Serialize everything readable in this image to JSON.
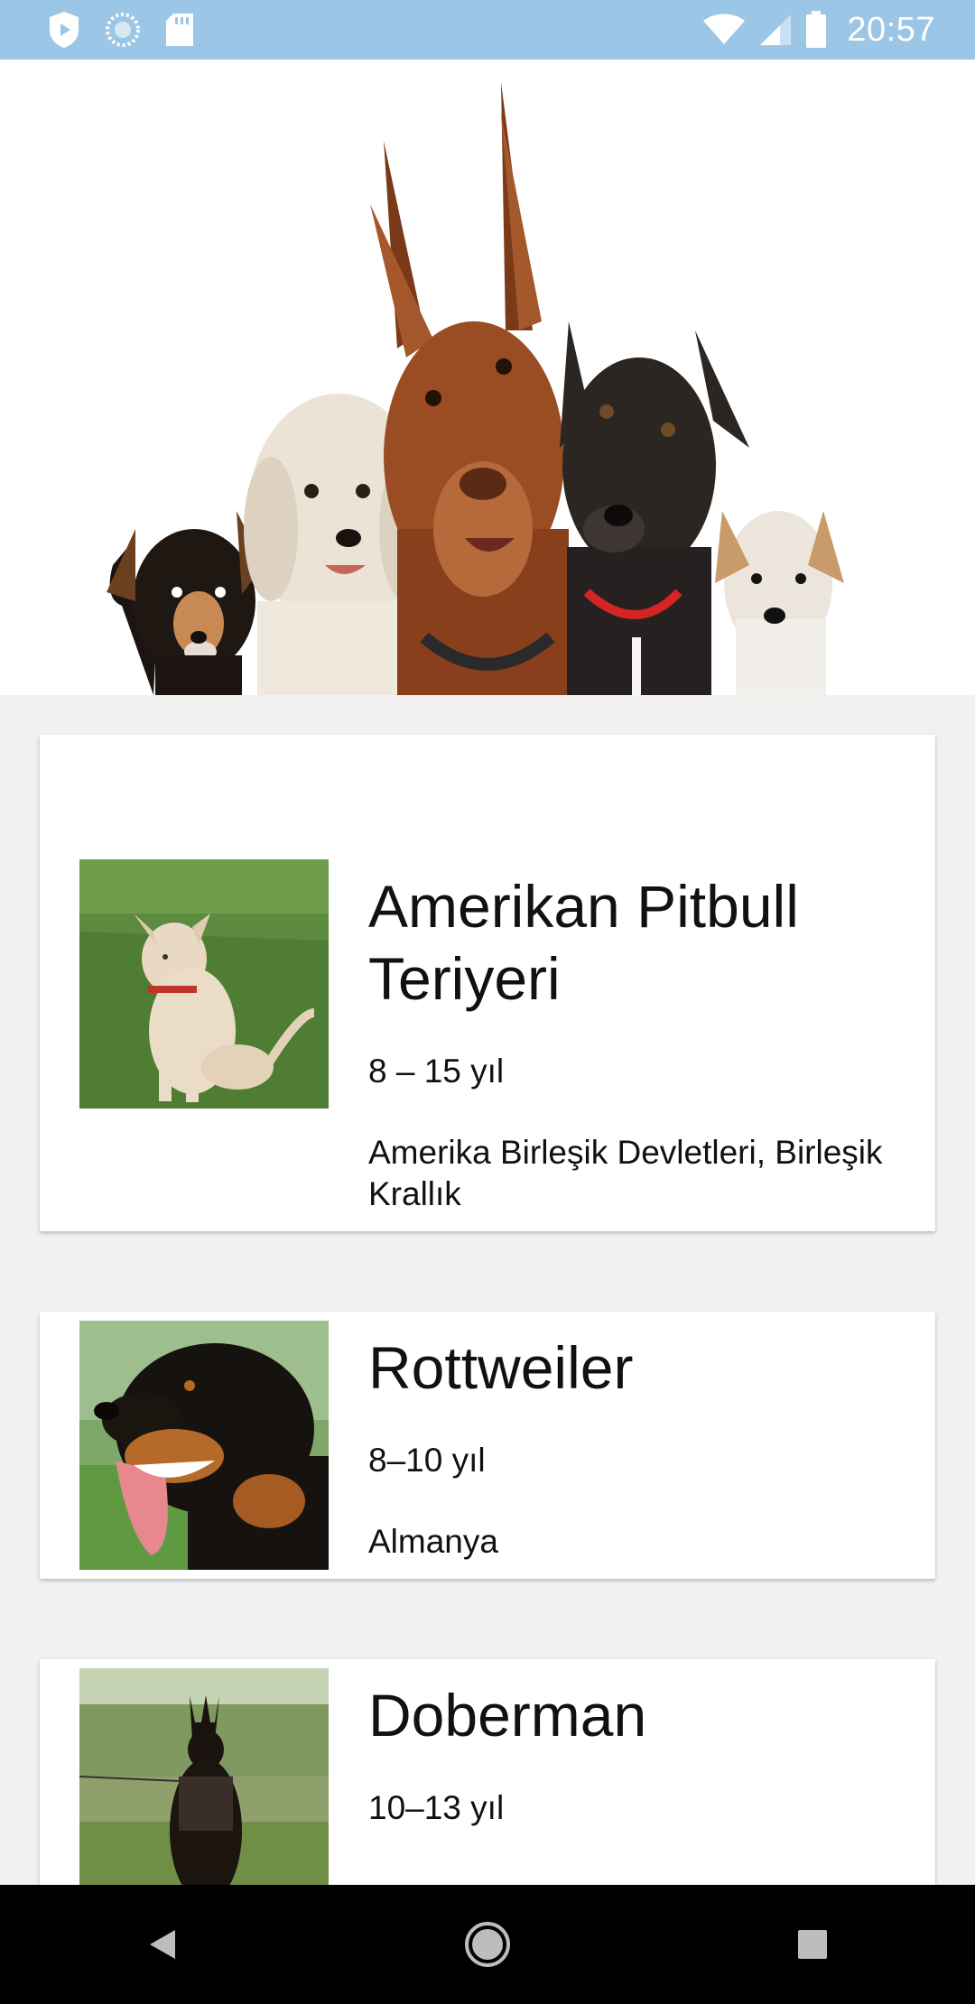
{
  "status_bar": {
    "time": "20:57",
    "icons": [
      "play-protect-icon",
      "sync-icon",
      "sd-card-icon",
      "wifi-icon",
      "signal-icon",
      "battery-icon"
    ]
  },
  "hero": {
    "image": "group-of-dogs-banner"
  },
  "breeds": [
    {
      "name": "Amerikan Pitbull Teriyeri",
      "life_span": "8 – 15 yıl",
      "origin": "Amerika Birleşik Devletleri, Birleşik Krallık",
      "image": "pitbull-photo"
    },
    {
      "name": "Rottweiler",
      "life_span": "8–10 yıl",
      "origin": "Almanya",
      "image": "rottweiler-photo"
    },
    {
      "name": "Doberman",
      "life_span": "10–13 yıl",
      "origin": "",
      "image": "doberman-photo"
    }
  ],
  "nav_bar": {
    "buttons": [
      "back-icon",
      "home-icon",
      "recents-icon"
    ]
  },
  "colors": {
    "status_bar": "#9cc6e6",
    "background": "#f1f1f1",
    "card": "#ffffff",
    "nav_bar": "#000000"
  }
}
